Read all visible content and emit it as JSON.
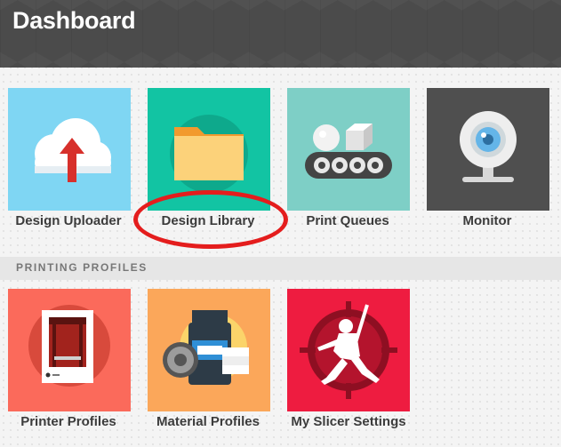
{
  "header": {
    "title": "Dashboard"
  },
  "tiles": [
    {
      "label": "Design Uploader",
      "color": "#7fd6f3",
      "icon": "cloud-upload-icon"
    },
    {
      "label": "Design Library",
      "color": "#12c4a3",
      "icon": "folder-icon"
    },
    {
      "label": "Print Queues",
      "color": "#7ecfc6",
      "icon": "conveyor-icon"
    },
    {
      "label": "Monitor",
      "color": "#4f4f4f",
      "icon": "webcam-icon"
    }
  ],
  "section": {
    "title": "PRINTING PROFILES"
  },
  "profiles": [
    {
      "label": "Printer Profiles",
      "color": "#fb6a5b",
      "icon": "printer-icon"
    },
    {
      "label": "Material Profiles",
      "color": "#fba75a",
      "icon": "filament-icon"
    },
    {
      "label": "My Slicer Settings",
      "color": "#ee1c40",
      "icon": "ninja-icon"
    }
  ],
  "annotation": {
    "color": "#e41d1d",
    "target": "Design Library"
  }
}
